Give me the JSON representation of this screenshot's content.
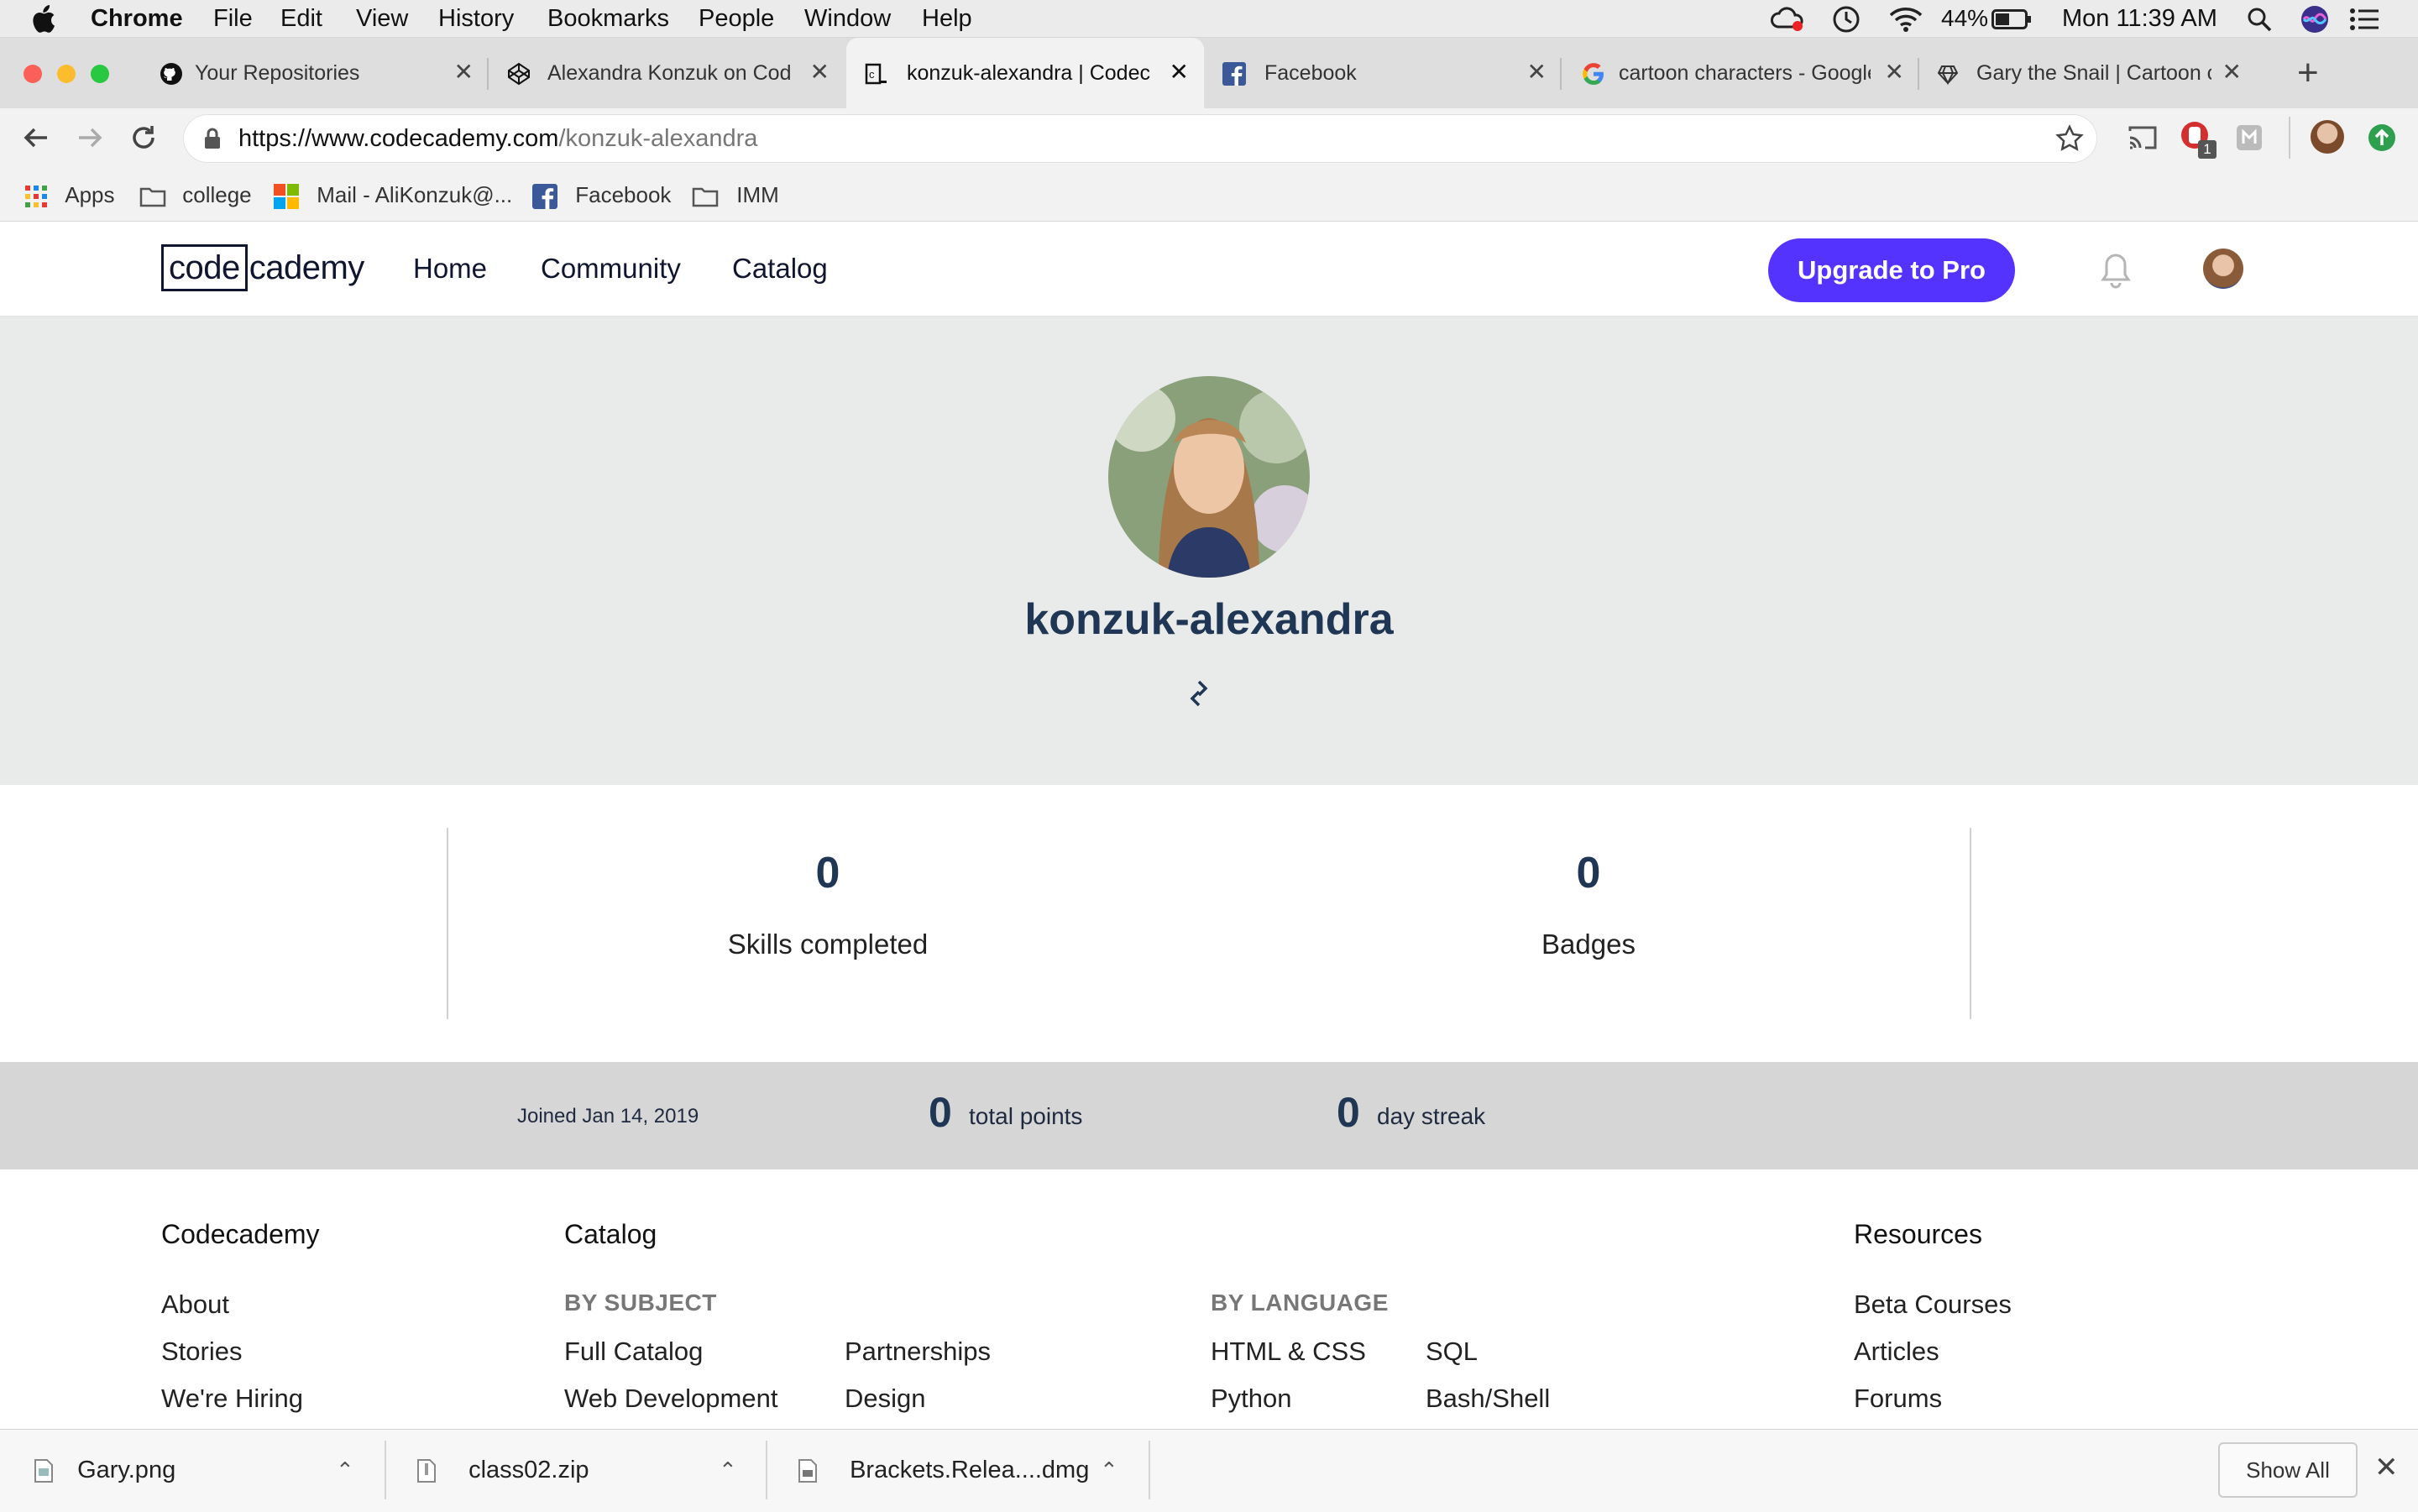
{
  "menubar": {
    "app": "Chrome",
    "items": [
      "File",
      "Edit",
      "View",
      "History",
      "Bookmarks",
      "People",
      "Window",
      "Help"
    ],
    "battery": "44%",
    "clock": "Mon 11:39 AM"
  },
  "tabs": [
    {
      "title": "Your Repositories",
      "icon": "github-icon"
    },
    {
      "title": "Alexandra Konzuk on CodePen",
      "icon": "codepen-icon"
    },
    {
      "title": "konzuk-alexandra | Codecademy",
      "icon": "codecademy-icon"
    },
    {
      "title": "Facebook",
      "icon": "facebook-icon"
    },
    {
      "title": "cartoon characters - Google Search",
      "icon": "google-icon"
    },
    {
      "title": "Gary the Snail | Cartoon characters",
      "icon": "site-icon"
    }
  ],
  "address": {
    "scheme_host": "https://www.codecademy.com",
    "path": "/konzuk-alexandra"
  },
  "extension_badge": "1",
  "bookmarks": [
    {
      "label": "Apps",
      "icon": "apps-grid-icon"
    },
    {
      "label": "college",
      "icon": "folder-icon"
    },
    {
      "label": "Mail - AliKonzuk@...",
      "icon": "outlook-icon"
    },
    {
      "label": "Facebook",
      "icon": "facebook-icon"
    },
    {
      "label": "IMM",
      "icon": "folder-icon"
    }
  ],
  "site": {
    "logo_left": "code",
    "logo_right": "cademy",
    "nav": [
      "Home",
      "Community",
      "Catalog"
    ],
    "upgrade": "Upgrade to Pro",
    "accent": "#5533ff",
    "brand_text": "#10162f"
  },
  "profile": {
    "username": "konzuk-alexandra",
    "skills_count": "0",
    "skills_label": "Skills completed",
    "badges_count": "0",
    "badges_label": "Badges",
    "joined": "Joined Jan 14, 2019",
    "points_count": "0",
    "points_label": "total points",
    "streak_count": "0",
    "streak_label": "day streak"
  },
  "footer": {
    "col1_title": "Codecademy",
    "col1_links": [
      "About",
      "Stories",
      "We're Hiring"
    ],
    "catalog_title": "Catalog",
    "by_subject": "BY SUBJECT",
    "subject_col1": [
      "Full Catalog",
      "Web Development"
    ],
    "subject_col2": [
      "Partnerships",
      "Design"
    ],
    "by_language": "BY LANGUAGE",
    "lang_col1": [
      "HTML & CSS",
      "Python"
    ],
    "lang_col2": [
      "SQL",
      "Bash/Shell"
    ],
    "resources_title": "Resources",
    "resources_links": [
      "Beta Courses",
      "Articles",
      "Forums"
    ]
  },
  "downloads": {
    "items": [
      "Gary.png",
      "class02.zip",
      "Brackets.Relea....dmg"
    ],
    "show_all": "Show All"
  }
}
